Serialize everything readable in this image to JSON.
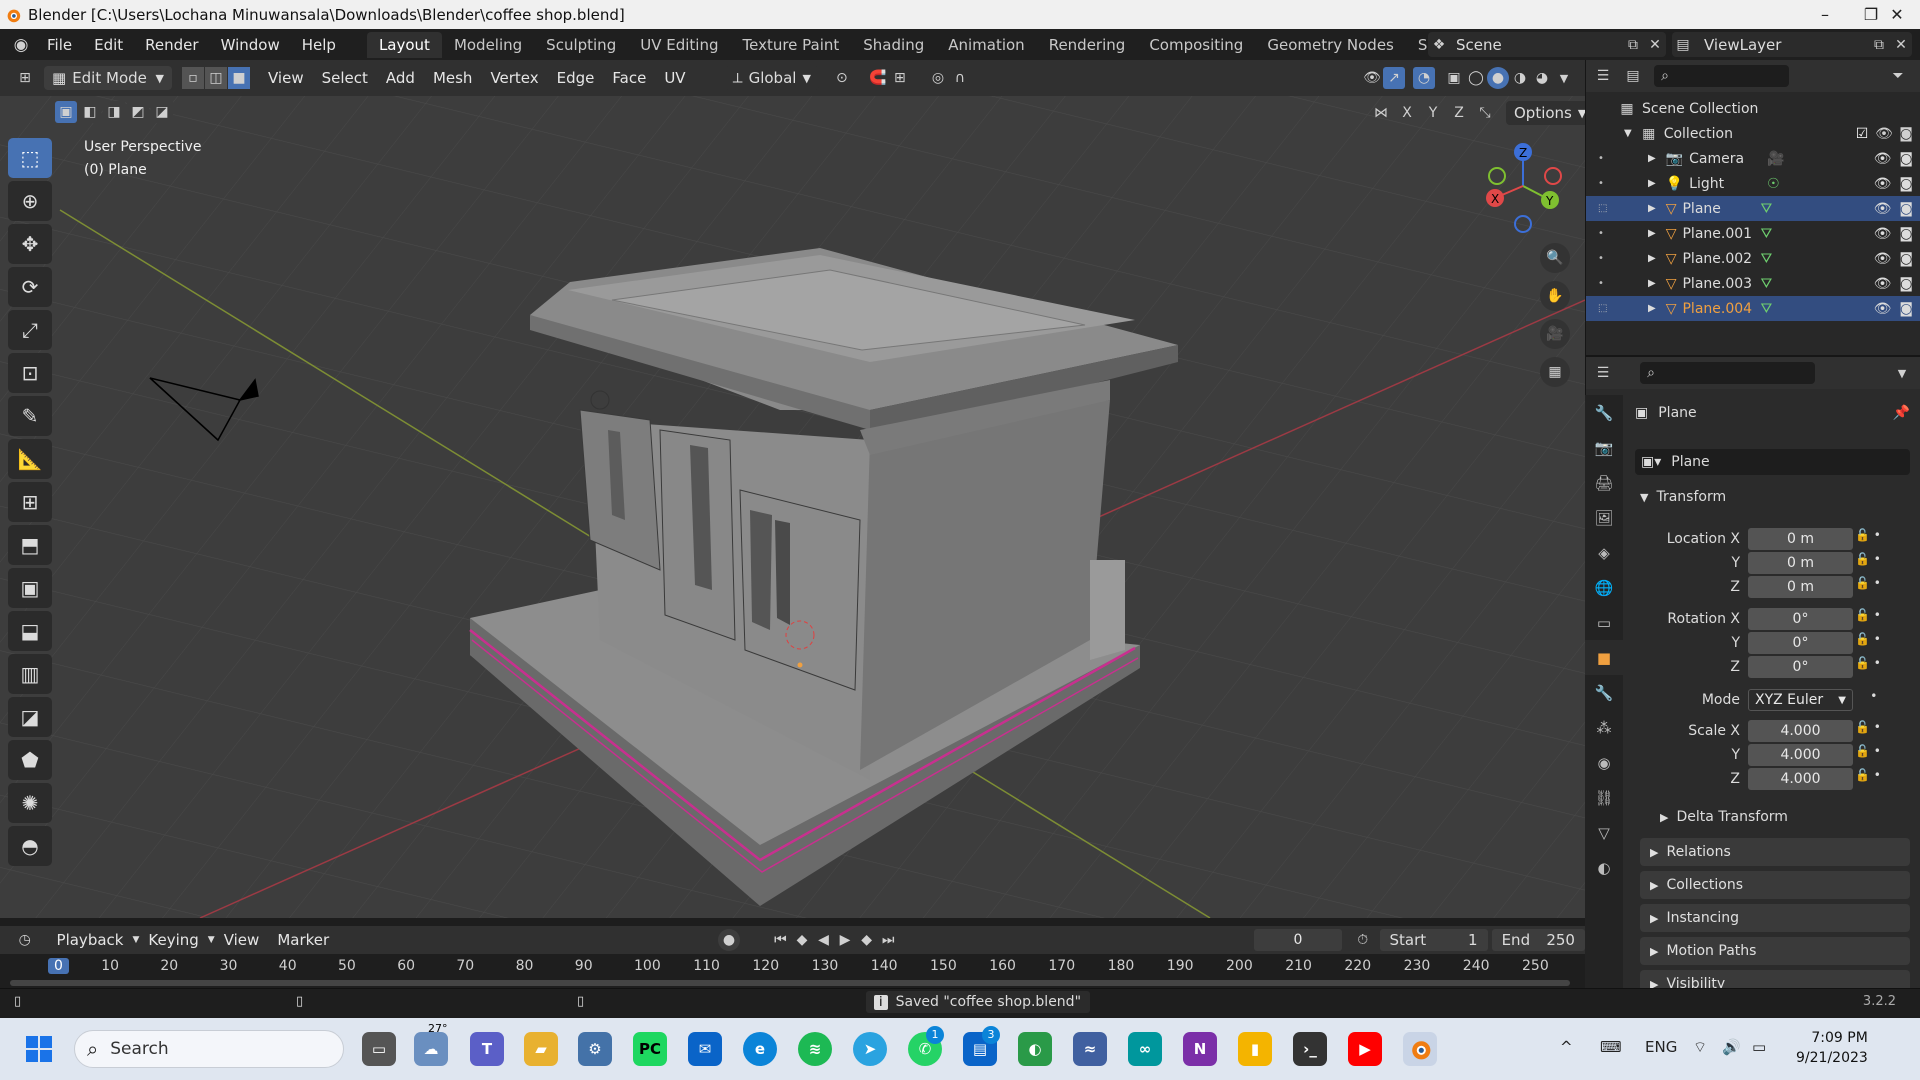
{
  "window": {
    "title": "Blender [C:\\Users\\Lochana Minuwansala\\Downloads\\Blender\\coffee shop.blend]",
    "buttons": [
      "–",
      "❐",
      "✕"
    ]
  },
  "menu": [
    "File",
    "Edit",
    "Render",
    "Window",
    "Help"
  ],
  "workspaces": [
    "Layout",
    "Modeling",
    "Sculpting",
    "UV Editing",
    "Texture Paint",
    "Shading",
    "Animation",
    "Rendering",
    "Compositing",
    "Geometry Nodes",
    "Scripting",
    "+"
  ],
  "active_workspace": "Layout",
  "scene": "Scene",
  "view_layer": "ViewLayer",
  "header": {
    "mode": "Edit Mode",
    "menus": [
      "View",
      "Select",
      "Add",
      "Mesh",
      "Vertex",
      "Edge",
      "Face",
      "UV"
    ],
    "orientation": "Global",
    "options": "Options",
    "axes": [
      "X",
      "Y",
      "Z"
    ]
  },
  "viewport": {
    "perspective": "User Perspective",
    "object": "(0) Plane",
    "gizmo": {
      "z": "Z",
      "y": "Y",
      "x": "X"
    }
  },
  "tools": [
    "select-box",
    "cursor",
    "move",
    "rotate",
    "scale",
    "transform",
    "annotate",
    "measure",
    "add-cube",
    "extrude",
    "inset",
    "bevel",
    "loop-cut",
    "knife",
    "poly-build",
    "spin",
    "smooth",
    "shear"
  ],
  "outliner": {
    "root": "Scene Collection",
    "collection": "Collection",
    "items": [
      {
        "name": "Camera",
        "type": "camera",
        "selected": false
      },
      {
        "name": "Light",
        "type": "light",
        "selected": false
      },
      {
        "name": "Plane",
        "type": "mesh",
        "selected": true
      },
      {
        "name": "Plane.001",
        "type": "mesh",
        "selected": false
      },
      {
        "name": "Plane.002",
        "type": "mesh",
        "selected": false
      },
      {
        "name": "Plane.003",
        "type": "mesh",
        "selected": false
      },
      {
        "name": "Plane.004",
        "type": "mesh",
        "selected": true
      }
    ]
  },
  "properties": {
    "object_name": "Plane",
    "datablock": "Plane",
    "transform_label": "Transform",
    "location_label": "Location X",
    "location": [
      "0 m",
      "0 m",
      "0 m"
    ],
    "rotation_label": "Rotation X",
    "rotation": [
      "0°",
      "0°",
      "0°"
    ],
    "mode_label": "Mode",
    "mode": "XYZ Euler",
    "scale_label": "Scale X",
    "scale": [
      "4.000",
      "4.000",
      "4.000"
    ],
    "axis_y": "Y",
    "axis_z": "Z",
    "sections": [
      "Delta Transform",
      "Relations",
      "Collections",
      "Instancing",
      "Motion Paths",
      "Visibility"
    ]
  },
  "timeline": {
    "menus": [
      "Playback",
      "Keying",
      "View",
      "Marker"
    ],
    "current_frame": "0",
    "start_label": "Start",
    "start": "1",
    "end_label": "End",
    "end": "250",
    "ticks": [
      "0",
      "10",
      "20",
      "30",
      "40",
      "50",
      "60",
      "70",
      "80",
      "90",
      "100",
      "110",
      "120",
      "130",
      "140",
      "150",
      "160",
      "170",
      "180",
      "190",
      "200",
      "210",
      "220",
      "230",
      "240",
      "250"
    ]
  },
  "status": {
    "message": "Saved \"coffee shop.blend\"",
    "version": "3.2.2"
  },
  "taskbar": {
    "search": "Search",
    "weather": "27°",
    "language": "ENG",
    "time": "7:09 PM",
    "date": "9/21/2023",
    "badges": {
      "whatsapp": "1",
      "mail": "3"
    }
  },
  "colors": {
    "accent": "#4772b3",
    "selected_row": "#334d80",
    "orange": "#f0a040",
    "viewport_bg": "#3d3d3d"
  }
}
